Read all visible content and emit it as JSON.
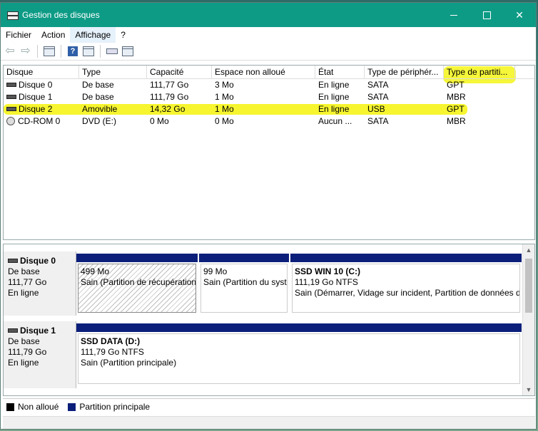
{
  "window": {
    "title": "Gestion des disques"
  },
  "menu": [
    "Fichier",
    "Action",
    "Affichage",
    "?"
  ],
  "toolbar": {
    "icons": [
      "back-icon",
      "forward-icon",
      "properties-icon",
      "help-icon",
      "view-icon",
      "rescan-icon",
      "list-icon"
    ]
  },
  "volume_list": {
    "columns": [
      "Disque",
      "Type",
      "Capacité",
      "Espace non alloué",
      "État",
      "Type de périphér...",
      "Type de partiti..."
    ],
    "rows": [
      [
        "Disque 0",
        "De base",
        "111,77 Go",
        "3 Mo",
        "En ligne",
        "SATA",
        "GPT"
      ],
      [
        "Disque 1",
        "De base",
        "111,79 Go",
        "1 Mo",
        "En ligne",
        "SATA",
        "MBR"
      ],
      [
        "Disque 2",
        "Amovible",
        "14,32 Go",
        "1 Mo",
        "En ligne",
        "USB",
        "GPT"
      ],
      [
        "CD-ROM 0",
        "DVD (E:)",
        "0 Mo",
        "0 Mo",
        "Aucun ...",
        "SATA",
        "MBR"
      ]
    ],
    "highlighted_row": "Disque 2",
    "highlight_color": "#f6f52f"
  },
  "disks": [
    {
      "name": "Disque 0",
      "kind": "De base",
      "size": "111,77 Go",
      "status": "En ligne",
      "partitions": [
        {
          "title": "",
          "line1": "499 Mo",
          "line2": "Sain (Partition de récupération)",
          "hatched": true
        },
        {
          "title": "",
          "line1": "99 Mo",
          "line2": "Sain (Partition du système EFI)",
          "hatched": false
        },
        {
          "title": "SSD WIN 10  (C:)",
          "line1": "111,19 Go NTFS",
          "line2": "Sain (Démarrer, Vidage sur incident, Partition de données de base)",
          "hatched": false
        }
      ]
    },
    {
      "name": "Disque 1",
      "kind": "De base",
      "size": "111,79 Go",
      "status": "En ligne",
      "partitions": [
        {
          "title": "SSD DATA  (D:)",
          "line1": "111,79 Go NTFS",
          "line2": "Sain (Partition principale)",
          "hatched": false
        }
      ]
    }
  ],
  "legend": [
    {
      "label": "Non alloué",
      "color": "#000000"
    },
    {
      "label": "Partition principale",
      "color": "#0b1f7a"
    }
  ],
  "colors": {
    "titlebar": "#0e9b86",
    "partition_bar": "#0b1f7a"
  }
}
